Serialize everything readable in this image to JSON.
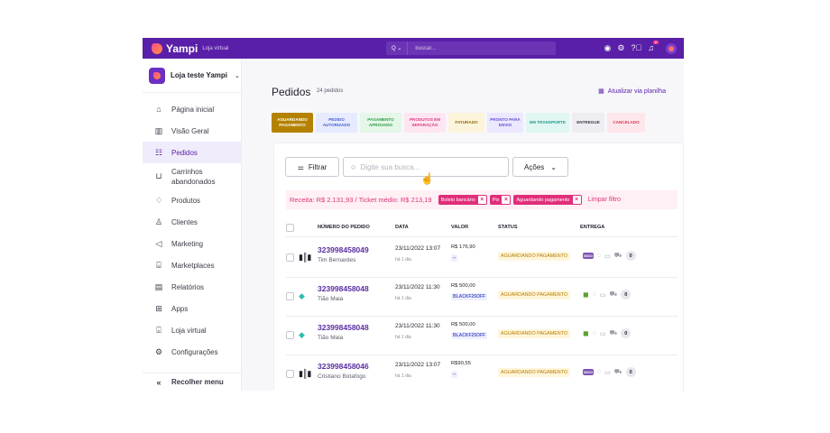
{
  "topbar": {
    "brand": "Yampi",
    "brand_sub": "Loja virtual",
    "search_scope": "Q",
    "search_placeholder": "buscar...",
    "notification_count": "2",
    "icons": [
      "eye-icon",
      "gear-icon",
      "help-icon",
      "bell-icon",
      "avatar"
    ]
  },
  "sidebar": {
    "store_name": "Loja teste Yampi",
    "items": [
      {
        "label": "Página inicial",
        "icon": "⌂"
      },
      {
        "label": "Visão Geral",
        "icon": "▥"
      },
      {
        "label": "Pedidos",
        "icon": "☷"
      },
      {
        "label": "Carrinhos abandonados",
        "icon": "⊔"
      },
      {
        "label": "Produtos",
        "icon": "♢"
      },
      {
        "label": "Clientes",
        "icon": "♙"
      },
      {
        "label": "Marketing",
        "icon": "◁"
      },
      {
        "label": "Marketplaces",
        "icon": "⌸"
      },
      {
        "label": "Relatórios",
        "icon": "▤"
      },
      {
        "label": "Apps",
        "icon": "⊞"
      },
      {
        "label": "Loja virtual",
        "icon": "⌺"
      },
      {
        "label": "Configurações",
        "icon": "⚙"
      }
    ],
    "collapse_label": "Recolher menu"
  },
  "main": {
    "title": "Pedidos",
    "count": "24 pedidos",
    "update_link": "Atualizar via planilha",
    "status_chips": [
      {
        "label": "Aguardando pagamento",
        "bg": "#b58200",
        "fg": "#ffffff",
        "w": 46
      },
      {
        "label": "Pedido autorizado",
        "bg": "#e6ebff",
        "fg": "#4a5fd0",
        "w": 46
      },
      {
        "label": "Pagamento aprovado",
        "bg": "#e4f7e8",
        "fg": "#2e9a48",
        "w": 46
      },
      {
        "label": "Produtos em separação",
        "bg": "#fde6f1",
        "fg": "#d93a85",
        "w": 46
      },
      {
        "label": "Faturado",
        "bg": "#fdf4dc",
        "fg": "#8a6a10",
        "w": 40
      },
      {
        "label": "Pronto para envio",
        "bg": "#ece8fd",
        "fg": "#6a4fd6",
        "w": 40
      },
      {
        "label": "Em transporte",
        "bg": "#e0f6f3",
        "fg": "#1f9a8a",
        "w": 48
      },
      {
        "label": "Entregue",
        "bg": "#eeeef2",
        "fg": "#3a3a48",
        "w": 36
      },
      {
        "label": "Cancelado",
        "bg": "#fde7ec",
        "fg": "#d9374f",
        "w": 42
      }
    ],
    "filter_button": "Filtrar",
    "search_placeholder": "Digite sua busca...",
    "actions_button": "Ações",
    "receita": "Receita: R$ 2.131,93 / Ticket médio: R$ 213,19",
    "filter_tags": [
      "Boleto bancário",
      "Pix",
      "Aguardando pagamento"
    ],
    "clear_filter": "Limpar filtro",
    "columns": [
      "Número do pedido",
      "Data",
      "Valor",
      "Status",
      "Entrega"
    ],
    "orders": [
      {
        "number": "323998458049",
        "customer": "Tim Bernardes",
        "date": "23/11/2022 13:07",
        "ago": "há 1 dia",
        "value": "R$ 176,90",
        "coupon": "--",
        "status": "Aguardando pagamento",
        "type": "barcode",
        "platform": "woo",
        "count": "0"
      },
      {
        "number": "323998458048",
        "customer": "Tião Maia",
        "date": "23/11/2022 11:30",
        "ago": "há 1 dia",
        "value": "R$ 500,00",
        "coupon": "BLACKF25OFF",
        "status": "Aguardando pagamento",
        "type": "pix",
        "platform": "shopify",
        "count": "0"
      },
      {
        "number": "323998458048",
        "customer": "Tião Maia",
        "date": "23/11/2022 11:30",
        "ago": "há 1 dia",
        "value": "R$ 500,00",
        "coupon": "BLACKF25OFF",
        "status": "Aguardando pagamento",
        "type": "pix",
        "platform": "shopify",
        "count": "0"
      },
      {
        "number": "323998458046",
        "customer": "Cristiano Botafogo",
        "date": "23/11/2022 13:07",
        "ago": "há 1 dia",
        "value": "R$90,55",
        "coupon": "--",
        "status": "Aguardando pagamento",
        "type": "barcode",
        "platform": "woo",
        "count": "0"
      }
    ]
  }
}
